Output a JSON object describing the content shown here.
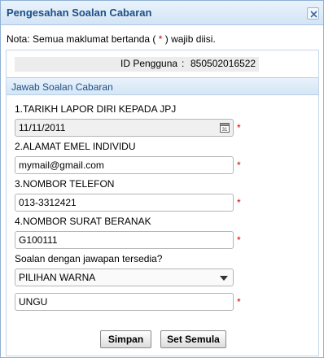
{
  "dialog": {
    "title": "Pengesahan Soalan Cabaran",
    "close_icon": "close-icon"
  },
  "note": {
    "prefix": "Nota: Semua maklumat bertanda (",
    "marker": " * ",
    "suffix": ") wajib diisi."
  },
  "user": {
    "label": "ID Pengguna",
    "colon": ":",
    "value": "850502016522"
  },
  "section": {
    "title": "Jawab Soalan Cabaran"
  },
  "questions": [
    {
      "label": "1.TARIKH LAPOR DIRI KEPADA JPJ",
      "value": "11/11/2011",
      "icon": "calendar-icon",
      "required": "*"
    },
    {
      "label": "2.ALAMAT EMEL INDIVIDU",
      "value": "mymail@gmail.com",
      "required": "*"
    },
    {
      "label": "3.NOMBOR TELEFON",
      "value": "013-3312421",
      "required": "*"
    },
    {
      "label": "4.NOMBOR SURAT BERANAK",
      "value": "G100111",
      "required": "*"
    }
  ],
  "challenge": {
    "label": "Soalan dengan jawapan tersedia?",
    "selected": "PILIHAN WARNA",
    "answer": "UNGU",
    "required": "*"
  },
  "calendar_day": "31",
  "buttons": {
    "save": "Simpan",
    "reset": "Set Semula"
  }
}
